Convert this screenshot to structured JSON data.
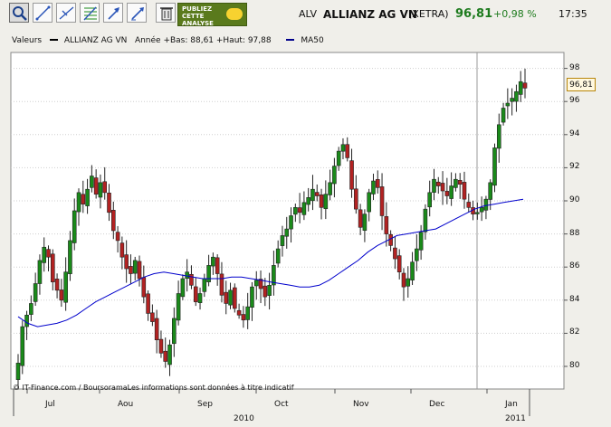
{
  "toolbar": {
    "tools": [
      {
        "name": "zoom-tool",
        "icon": "zoom-icon",
        "active": true
      },
      {
        "name": "trend-line-tool",
        "icon": "trend-line-icon"
      },
      {
        "name": "cross-line-tool",
        "icon": "cross-line-icon"
      },
      {
        "name": "fibonacci-tool",
        "icon": "fibonacci-icon"
      },
      {
        "name": "arrow-tool",
        "icon": "arrow-up-icon"
      },
      {
        "name": "annotate-tool",
        "icon": "pencil-icon"
      },
      {
        "name": "delete-tool",
        "icon": "trash-icon"
      }
    ],
    "promo": {
      "line1": "PUBLIEZ",
      "line2": "CETTE",
      "line3": "ANALYSE"
    }
  },
  "quote": {
    "symbol": "ALV",
    "name": "ALLIANZ AG VN",
    "exchange": "(XETRA)",
    "price": "96,81",
    "change": "+0,98 %",
    "time": "17:35",
    "up_color": "#1e7b1e"
  },
  "legend": {
    "label": "Valeurs",
    "series_name": "ALLIANZ AG VN",
    "stats": "Année +Bas: 88,61 +Haut: 97,88",
    "ma_name": "MA50",
    "series_color": "#000000",
    "ma_color": "#00008b"
  },
  "credit": "© IT-Finance.com / BoursoramaLes informations sont données à titre indicatif",
  "last_price_label": "96,81",
  "chart_data": {
    "type": "candlestick",
    "y_ticks": [
      "80",
      "82",
      "84",
      "86",
      "88",
      "90",
      "92",
      "94",
      "96",
      "98"
    ],
    "ylim": [
      79.2,
      98.4
    ],
    "months": [
      "Jul",
      "Aou",
      "Sep",
      "Oct",
      "Nov",
      "Dec",
      "Jan"
    ],
    "years": [
      "2010",
      "2011"
    ],
    "colors": {
      "up": "#1a8a1a",
      "down": "#b22222",
      "ma": "#0000cc",
      "grid": "#cfcfcf"
    },
    "series": {
      "name": "ALLIANZ AG VN",
      "close": [
        80.2,
        82.4,
        83.1,
        83.8,
        85.0,
        86.4,
        87.2,
        86.6,
        85.1,
        84.6,
        84.0,
        85.7,
        87.6,
        89.4,
        90.5,
        89.8,
        90.7,
        91.5,
        90.4,
        91.1,
        90.5,
        89.3,
        88.2,
        87.6,
        86.6,
        85.9,
        85.6,
        86.4,
        85.3,
        84.2,
        83.2,
        82.7,
        81.6,
        80.8,
        80.3,
        81.3,
        82.9,
        84.4,
        85.3,
        85.7,
        84.9,
        83.9,
        84.4,
        85.3,
        86.1,
        86.6,
        85.6,
        84.3,
        83.8,
        84.6,
        83.5,
        83.1,
        82.8,
        83.6,
        84.8,
        85.2,
        84.7,
        84.2,
        84.9,
        86.1,
        87.1,
        87.9,
        88.3,
        89.1,
        89.6,
        89.3,
        89.9,
        90.2,
        90.7,
        90.3,
        89.6,
        90.4,
        91.1,
        92.1,
        93.0,
        93.4,
        92.6,
        90.7,
        89.5,
        88.4,
        89.2,
        90.5,
        91.2,
        90.8,
        89.1,
        88.0,
        87.3,
        86.5,
        85.7,
        84.8,
        85.3,
        86.3,
        87.1,
        88.1,
        89.5,
        90.5,
        91.3,
        90.9,
        90.6,
        90.3,
        90.9,
        91.3,
        91.0,
        90.1,
        89.6,
        89.2,
        89.3,
        89.6,
        90.1,
        91.1,
        93.2,
        94.6,
        95.6,
        95.9,
        96.2,
        96.6,
        97.2,
        96.81
      ],
      "ma50": [
        83.0,
        82.6,
        82.4,
        82.5,
        82.6,
        82.8,
        83.1,
        83.5,
        83.9,
        84.2,
        84.5,
        84.8,
        85.1,
        85.4,
        85.6,
        85.7,
        85.6,
        85.5,
        85.4,
        85.3,
        85.3,
        85.3,
        85.4,
        85.4,
        85.3,
        85.2,
        85.1,
        85.0,
        84.9,
        84.8,
        84.8,
        84.9,
        85.2,
        85.6,
        86.0,
        86.4,
        86.9,
        87.3,
        87.6,
        87.9,
        88.0,
        88.1,
        88.2,
        88.3,
        88.6,
        88.9,
        89.2,
        89.5,
        89.7,
        89.8,
        89.9,
        90.0,
        90.1
      ]
    }
  }
}
